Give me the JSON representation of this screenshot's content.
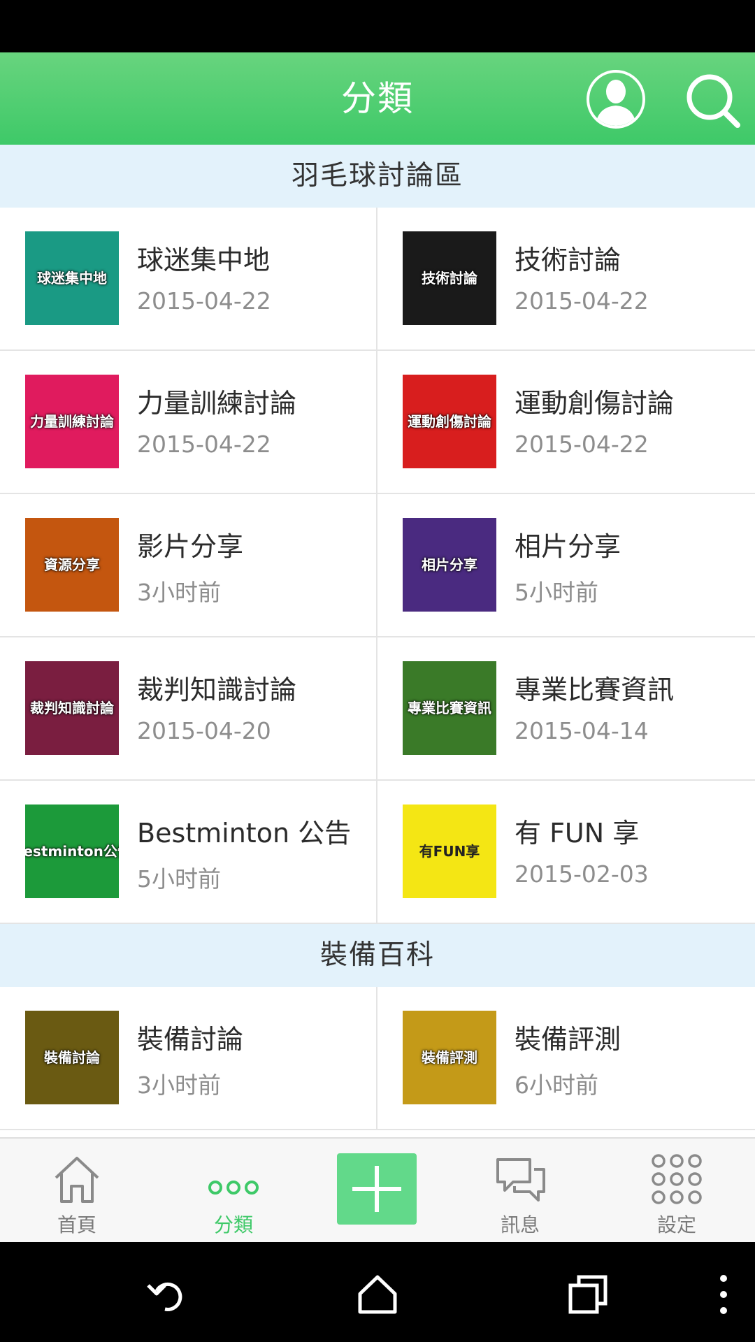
{
  "app_bar": {
    "title": "分類"
  },
  "sections": [
    {
      "title": "羽毛球討論區",
      "items": [
        {
          "name": "球迷集中地",
          "time": "2015-04-22",
          "thumb_text": "球迷集中地",
          "thumb_color": "#1a9a84"
        },
        {
          "name": "技術討論",
          "time": "2015-04-22",
          "thumb_text": "技術討論",
          "thumb_color": "#1a1a1a"
        },
        {
          "name": "力量訓練討論",
          "time": "2015-04-22",
          "thumb_text": "力量訓練討論",
          "thumb_color": "#e01b5e"
        },
        {
          "name": "運動創傷討論",
          "time": "2015-04-22",
          "thumb_text": "運動創傷討論",
          "thumb_color": "#d81e1e"
        },
        {
          "name": "影片分享",
          "time": "3小时前",
          "thumb_text": "資源分享",
          "thumb_color": "#c4560f"
        },
        {
          "name": "相片分享",
          "time": "5小时前",
          "thumb_text": "相片分享",
          "thumb_color": "#4a2a80"
        },
        {
          "name": "裁判知識討論",
          "time": "2015-04-20",
          "thumb_text": "裁判知識討論",
          "thumb_color": "#7a1e40"
        },
        {
          "name": "專業比賽資訊",
          "time": "2015-04-14",
          "thumb_text": "專業比賽資訊",
          "thumb_color": "#3a7a28"
        },
        {
          "name": "Bestminton 公告",
          "time": "5小时前",
          "thumb_text": "Bestminton公告",
          "thumb_color": "#1c9a3a"
        },
        {
          "name": "有 FUN 享",
          "time": "2015-02-03",
          "thumb_text": "有FUN享",
          "thumb_color": "#f4e614"
        }
      ]
    },
    {
      "title": "裝備百科",
      "items": [
        {
          "name": "裝備討論",
          "time": "3小时前",
          "thumb_text": "裝備討論",
          "thumb_color": "#6a5a12"
        },
        {
          "name": "裝備評測",
          "time": "6小时前",
          "thumb_text": "裝備評測",
          "thumb_color": "#c49a18"
        }
      ]
    }
  ],
  "bottom_nav": {
    "home_label": "首頁",
    "category_label": "分類",
    "messages_label": "訊息",
    "settings_label": "設定"
  },
  "colors": {
    "accent": "#3ec968",
    "section_bg": "#e3f2fb",
    "add_button": "#62d98a"
  }
}
